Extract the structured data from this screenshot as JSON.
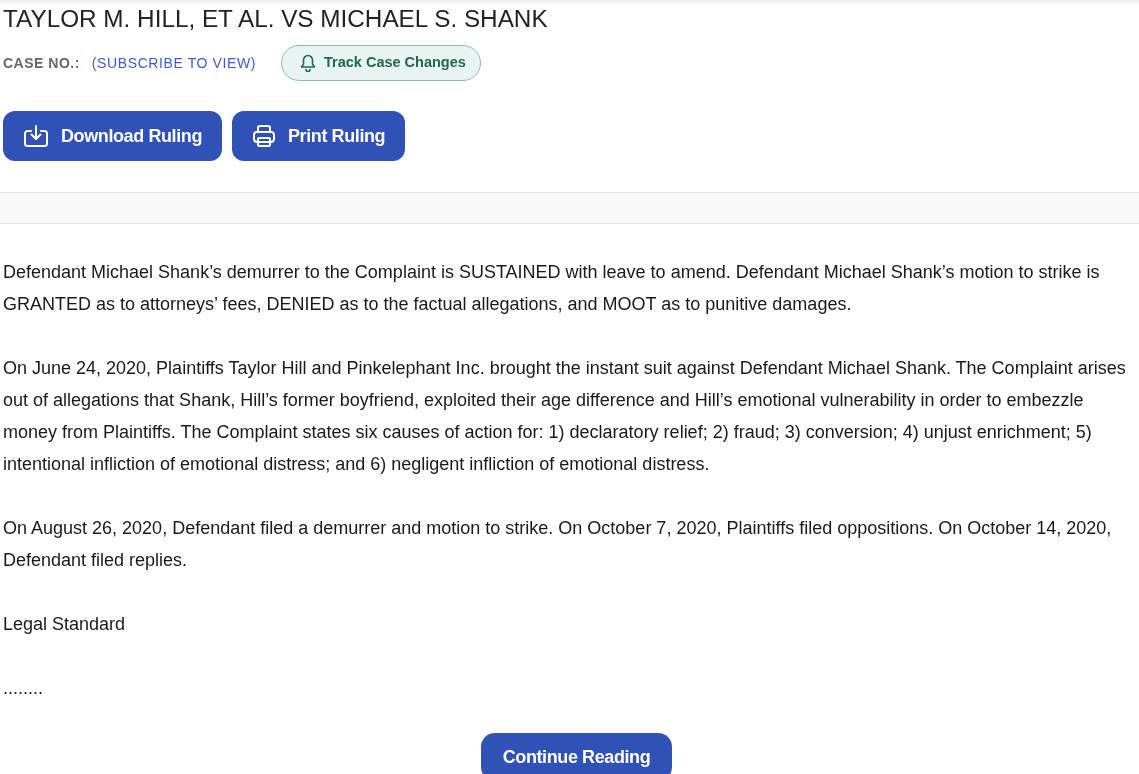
{
  "case": {
    "title": "TAYLOR M. HILL, ET AL. VS MICHAEL S. SHANK",
    "case_number_label": "CASE NO.:",
    "case_number_value": "(SUBSCRIBE TO VIEW)",
    "track_button": "Track Case Changes"
  },
  "actions": [
    {
      "kind": "download",
      "label": "Download Ruling"
    },
    {
      "kind": "print",
      "label": "Print Ruling"
    }
  ],
  "ruling": {
    "paragraphs": [
      "Defendant Michael Shank’s demurrer to the Complaint is SUSTAINED with leave to amend. Defendant Michael Shank’s motion to strike is GRANTED as to attorneys’ fees, DENIED as to the factual allegations, and MOOT as to punitive damages.",
      "On June 24, 2020, Plaintiffs Taylor Hill and Pinkelephant Inc. brought the instant suit against Defendant Michael Shank. The Complaint arises out of allegations that Shank, Hill’s former boyfriend, exploited their age difference and Hill’s emotional vulnerability in order to embezzle money from Plaintiffs. The Complaint states six causes of action for: 1) declaratory relief; 2) fraud; 3) conversion; 4) unjust enrichment; 5) intentional infliction of emotional distress; and 6) negligent infliction of emotional distress.",
      "On August 26, 2020, Defendant filed a demurrer and motion to strike. On October 7, 2020, Plaintiffs filed oppositions. On October 14, 2020, Defendant filed replies.",
      "Legal Standard"
    ],
    "ellipsis": "........"
  },
  "continue_button": "Continue Reading"
}
